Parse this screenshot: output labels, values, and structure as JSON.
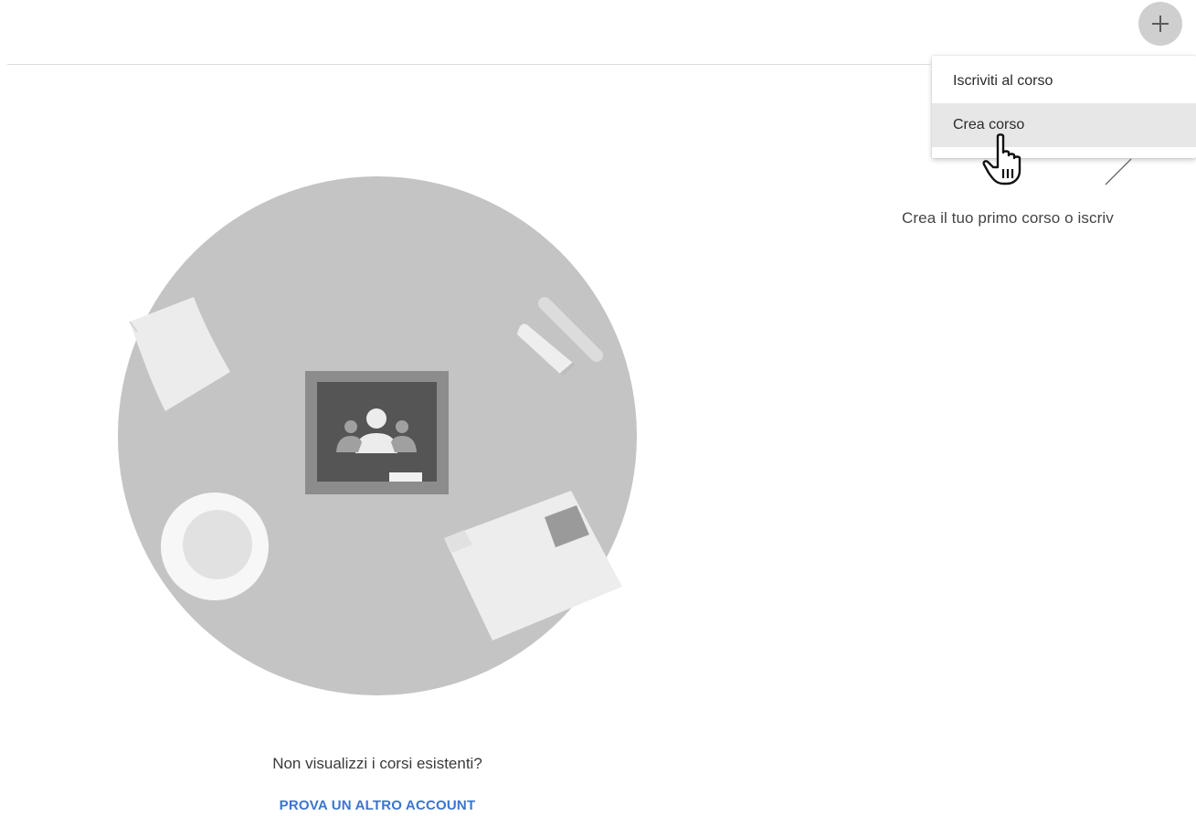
{
  "header": {
    "add_button_icon": "plus-icon"
  },
  "menu": {
    "items": [
      {
        "label": "Iscriviti al corso",
        "active": false
      },
      {
        "label": "Crea corso",
        "active": true
      }
    ]
  },
  "hint": {
    "text": "Crea il tuo primo corso o iscriv"
  },
  "illustration": {
    "icon": "google-classroom-icon"
  },
  "empty_state": {
    "prompt": "Non visualizzi i corsi esistenti?",
    "link_label": "PROVA UN ALTRO ACCOUNT"
  },
  "colors": {
    "link": "#3b74d1",
    "menu_active_bg": "#e7e7e7",
    "illustration_circle": "#c4c4c4"
  }
}
